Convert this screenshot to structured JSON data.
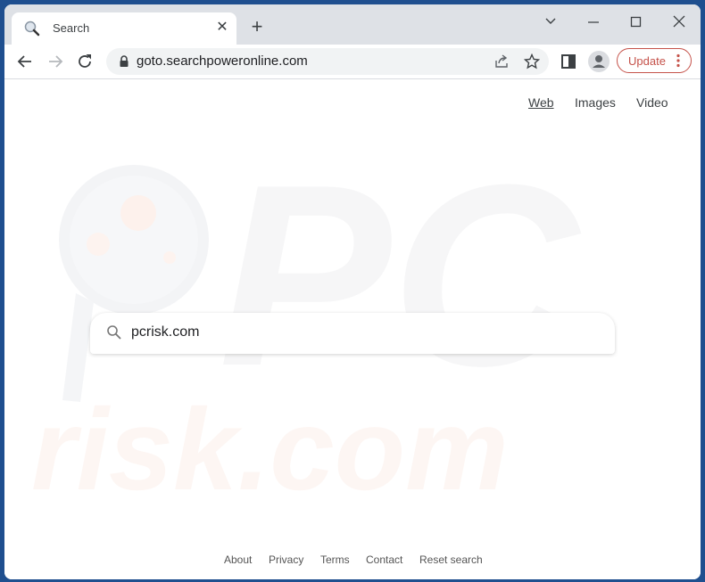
{
  "browser": {
    "tab": {
      "title": "Search",
      "favicon": "magnifier-icon"
    },
    "new_tab_icon": "plus-icon",
    "window_controls": [
      "chevron-down-icon",
      "minimize-icon",
      "maximize-icon",
      "close-icon"
    ],
    "url": "goto.searchpoweronline.com",
    "update_label": "Update"
  },
  "page": {
    "top_nav": [
      {
        "label": "Web",
        "active": true
      },
      {
        "label": "Images",
        "active": false
      },
      {
        "label": "Video",
        "active": false
      }
    ],
    "search": {
      "value": "pcrisk.com",
      "placeholder": ""
    },
    "watermark": {
      "line1": "PC",
      "line2": "risk.com"
    },
    "footer_links": [
      "About",
      "Privacy",
      "Terms",
      "Contact",
      "Reset search"
    ]
  },
  "colors": {
    "update_accent": "#c5524a",
    "frame": "#1f4f8f"
  }
}
